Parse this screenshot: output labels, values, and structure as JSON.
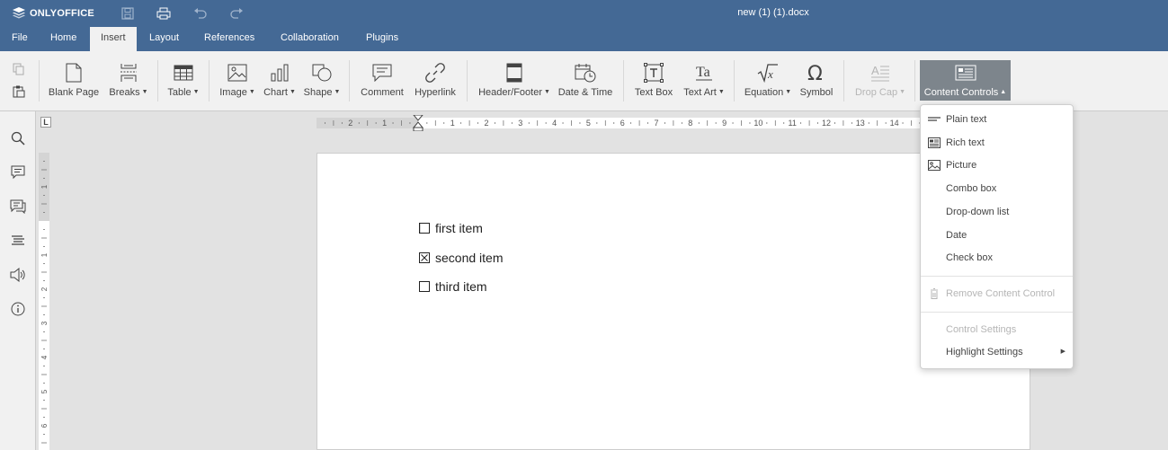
{
  "app": {
    "brand": "ONLYOFFICE",
    "document_title": "new (1) (1).docx"
  },
  "colors": {
    "header": "#446995",
    "toolbar": "#f1f1f1",
    "canvas": "#e2e2e2",
    "pressed": "#7d858c"
  },
  "menu_tabs": [
    "File",
    "Home",
    "Insert",
    "Layout",
    "References",
    "Collaboration",
    "Plugins"
  ],
  "active_tab": "Insert",
  "toolbar": {
    "blank_page": "Blank Page",
    "breaks": "Breaks",
    "table": "Table",
    "image": "Image",
    "chart": "Chart",
    "shape": "Shape",
    "comment": "Comment",
    "hyperlink": "Hyperlink",
    "header_footer": "Header/Footer",
    "date_time": "Date & Time",
    "text_box": "Text Box",
    "text_art": "Text Art",
    "equation": "Equation",
    "symbol": "Symbol",
    "drop_cap": "Drop Cap",
    "content_controls": "Content Controls"
  },
  "ruler": {
    "h_labels": [
      "2",
      "1",
      "1",
      "2",
      "3",
      "4",
      "5",
      "6",
      "7",
      "8",
      "9",
      "10",
      "11",
      "12",
      "13",
      "14"
    ],
    "v_labels": [
      "1",
      "1",
      "2",
      "3",
      "4",
      "5",
      "6"
    ],
    "corner": "L"
  },
  "document": {
    "items": [
      {
        "text": "first item",
        "checked": false
      },
      {
        "text": "second item",
        "checked": true
      },
      {
        "text": "third item",
        "checked": false
      }
    ]
  },
  "content_controls_menu": {
    "plain_text": "Plain text",
    "rich_text": "Rich text",
    "picture": "Picture",
    "combo_box": "Combo box",
    "dropdown_list": "Drop-down list",
    "date": "Date",
    "check_box": "Check box",
    "remove": "Remove Content Control",
    "control_settings": "Control Settings",
    "highlight_settings": "Highlight Settings"
  }
}
